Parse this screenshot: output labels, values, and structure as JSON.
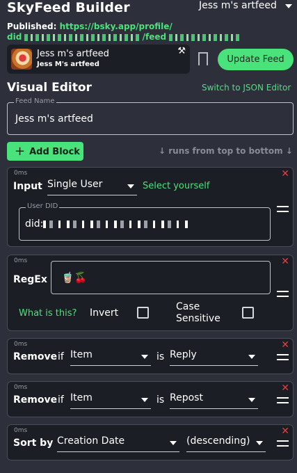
{
  "app": {
    "title": "SkyFeed Builder"
  },
  "feed_selector": {
    "value": "Jess m's artfeed"
  },
  "published": {
    "label": "Published:",
    "url_start": "https://bsky.app/profile/",
    "url_line2_start": "did",
    "url_mid": "/feed"
  },
  "feed_card": {
    "name": "Jess m's artfeed",
    "author": "Jess M's artfeed",
    "tools_icon": "tools-icon"
  },
  "actions": {
    "update_label": "Update Feed",
    "bookmark_icon": "bookmark-icon"
  },
  "editor": {
    "title": "Visual Editor",
    "switch_label": "Switch to JSON Editor"
  },
  "feed_name": {
    "legend": "Feed Name",
    "value": "Jess m's artfeed"
  },
  "add_block": {
    "label": "Add Block",
    "icon": "+"
  },
  "runs_hint": "↓ runs from top to bottom ↓",
  "blocks": [
    {
      "ms": "0ms",
      "label": "Input",
      "select": "Single User",
      "link": "Select yourself",
      "did_legend": "User DID",
      "did_prefix": "did:"
    },
    {
      "ms": "0ms",
      "label": "RegEx",
      "regex_value": "🧋🍒",
      "help": "What is this?",
      "invert": "Invert",
      "case_sensitive": "Case Sensitive",
      "invert_checked": false,
      "case_checked": false
    },
    {
      "ms": "0ms",
      "label": "Remove",
      "if": "if",
      "subject": "Item",
      "is": "is",
      "value": "Reply"
    },
    {
      "ms": "0ms",
      "label": "Remove",
      "if": "if",
      "subject": "Item",
      "is": "is",
      "value": "Repost"
    },
    {
      "ms": "0ms",
      "label": "Sort by",
      "field": "Creation Date",
      "order": "(descending)"
    }
  ],
  "colors": {
    "background": "#2d303b",
    "card": "#1c1e26",
    "accent": "#4ae27a",
    "danger": "#ee3b3b"
  },
  "block_controls": {
    "close": "✕",
    "close_icon": "close-icon",
    "drag_icon": "drag-handle-icon"
  }
}
